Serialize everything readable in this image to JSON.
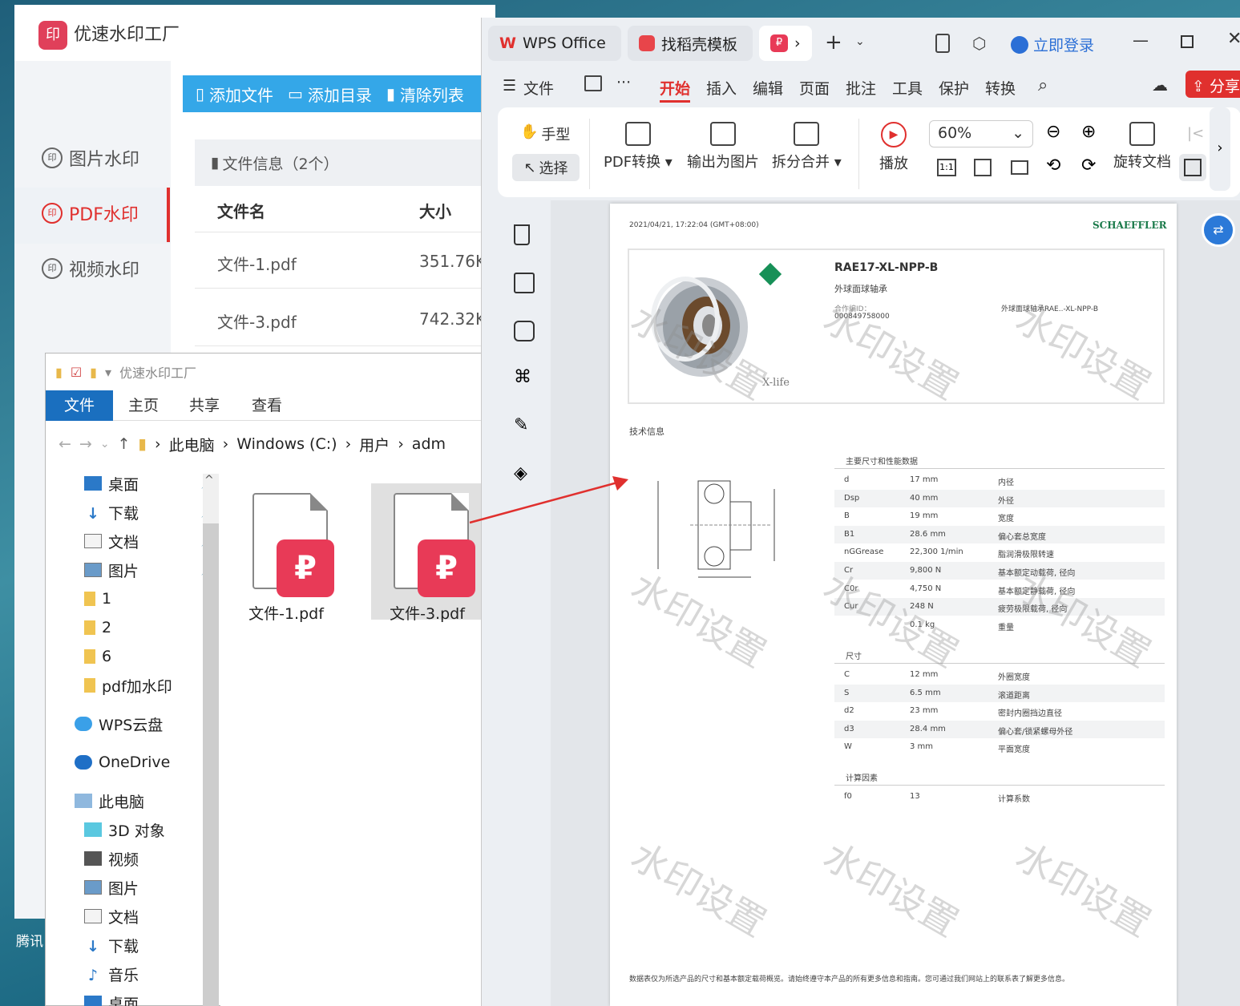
{
  "watermark_app": {
    "title": "优速水印工厂",
    "logo": "印",
    "sidebar": [
      {
        "label": "图片水印",
        "icon": "印"
      },
      {
        "label": "PDF水印",
        "icon": "印",
        "active": true
      },
      {
        "label": "视频水印",
        "icon": "印"
      }
    ],
    "toolbar": {
      "add_file": "添加文件",
      "add_dir": "添加目录",
      "clear_list": "清除列表"
    },
    "file_info": "文件信息（2个）",
    "columns": {
      "name": "文件名",
      "size": "大小"
    },
    "rows": [
      {
        "name": "文件-1.pdf",
        "size": "351.76K"
      },
      {
        "name": "文件-3.pdf",
        "size": "742.32K"
      }
    ]
  },
  "explorer": {
    "title": "优速水印工厂",
    "tabs": [
      "文件",
      "主页",
      "共享",
      "查看"
    ],
    "breadcrumb": [
      "此电脑",
      "Windows (C:)",
      "用户",
      "adm"
    ],
    "nav": [
      {
        "label": "桌面",
        "pinned": true,
        "icon": "desktop-icon"
      },
      {
        "label": "下载",
        "pinned": true,
        "icon": "download-icon"
      },
      {
        "label": "文档",
        "pinned": true,
        "icon": "document-icon"
      },
      {
        "label": "图片",
        "pinned": true,
        "icon": "picture-icon"
      },
      {
        "label": "1",
        "icon": "folder-icon"
      },
      {
        "label": "2",
        "icon": "folder-icon"
      },
      {
        "label": "6",
        "icon": "folder-icon"
      },
      {
        "label": "pdf加水印",
        "icon": "folder-icon"
      },
      {
        "label": "WPS云盘",
        "icon": "cloud-icon"
      },
      {
        "label": "OneDrive",
        "icon": "cloud-icon"
      },
      {
        "label": "此电脑",
        "icon": "computer-icon"
      },
      {
        "label": "3D 对象",
        "icon": "cube-icon"
      },
      {
        "label": "视频",
        "icon": "video-icon"
      },
      {
        "label": "图片",
        "icon": "picture-icon"
      },
      {
        "label": "文档",
        "icon": "document-icon"
      },
      {
        "label": "下载",
        "icon": "download-icon"
      },
      {
        "label": "音乐",
        "icon": "music-icon"
      },
      {
        "label": "桌面",
        "icon": "desktop-icon"
      }
    ],
    "files": [
      {
        "name": "文件-1.pdf"
      },
      {
        "name": "文件-3.pdf",
        "selected": true
      }
    ]
  },
  "wps": {
    "tabs": {
      "office": "WPS Office",
      "template": "找稻壳模板"
    },
    "login": "立即登录",
    "share": "分享",
    "menu": [
      "文件",
      "开始",
      "插入",
      "编辑",
      "页面",
      "批注",
      "工具",
      "保护",
      "转换"
    ],
    "menu_active": "开始",
    "ribbon": {
      "hand": "手型",
      "select": "选择",
      "pdf_convert": "PDF转换",
      "to_image": "输出为图片",
      "split_merge": "拆分合并",
      "play": "播放",
      "zoom": "60%",
      "rotate": "旋转文档",
      "fit": "1:1"
    }
  },
  "document": {
    "timestamp": "2021/04/21, 17:22:04 (GMT+08:00)",
    "brand": "SCHAEFFLER",
    "product": "RAE17-XL-NPP-B",
    "product_desc": "外球面球轴承",
    "order_label": "合作编ID：",
    "order_no": "000849758000",
    "product_ref": "外球面球轴承RAE..-XL-NPP-B",
    "xlife": "X-life",
    "section_tech": "技术信息",
    "section_main": "主要尺寸和性能数据",
    "main_rows": [
      {
        "sym": "d",
        "val": "17 mm",
        "desc": "内径"
      },
      {
        "sym": "Dsp",
        "val": "40 mm",
        "desc": "外径"
      },
      {
        "sym": "B",
        "val": "19 mm",
        "desc": "宽度"
      },
      {
        "sym": "B1",
        "val": "28.6 mm",
        "desc": "偏心套总宽度"
      },
      {
        "sym": "nGGrease",
        "val": "22,300 1/min",
        "desc": "脂润滑极限转速"
      },
      {
        "sym": "Cr",
        "val": "9,800 N",
        "desc": "基本额定动载荷, 径向"
      },
      {
        "sym": "C0r",
        "val": "4,750 N",
        "desc": "基本额定静载荷, 径向"
      },
      {
        "sym": "Cur",
        "val": "248 N",
        "desc": "疲劳极限载荷, 径向"
      },
      {
        "sym": "",
        "val": "0.1 kg",
        "desc": "重量"
      }
    ],
    "section_dim": "尺寸",
    "dim_rows": [
      {
        "sym": "C",
        "val": "12 mm",
        "desc": "外圈宽度"
      },
      {
        "sym": "S",
        "val": "6.5 mm",
        "desc": "滚道距离"
      },
      {
        "sym": "d2",
        "val": "23 mm",
        "desc": "密封内圈挡边直径"
      },
      {
        "sym": "d3",
        "val": "28.4 mm",
        "desc": "偏心套/锁紧螺母外径"
      },
      {
        "sym": "W",
        "val": "3 mm",
        "desc": "平面宽度"
      }
    ],
    "section_calc": "计算因素",
    "calc_rows": [
      {
        "sym": "f0",
        "val": "13",
        "desc": "计算系数"
      }
    ],
    "watermark_text": "水印设置",
    "footer": "数据表仅为所选产品的尺寸和基本额定载荷概览。请始终遵守本产品的所有更多信息和指南。您可通过我们网站上的联系表了解更多信息。"
  },
  "desktop": {
    "label_tx": "腾讯"
  },
  "colors": {
    "accent_red": "#e0302e",
    "wps_red": "#e83a57",
    "blue_toolbar": "#34a7e8",
    "explorer_blue": "#1a6fbf"
  }
}
